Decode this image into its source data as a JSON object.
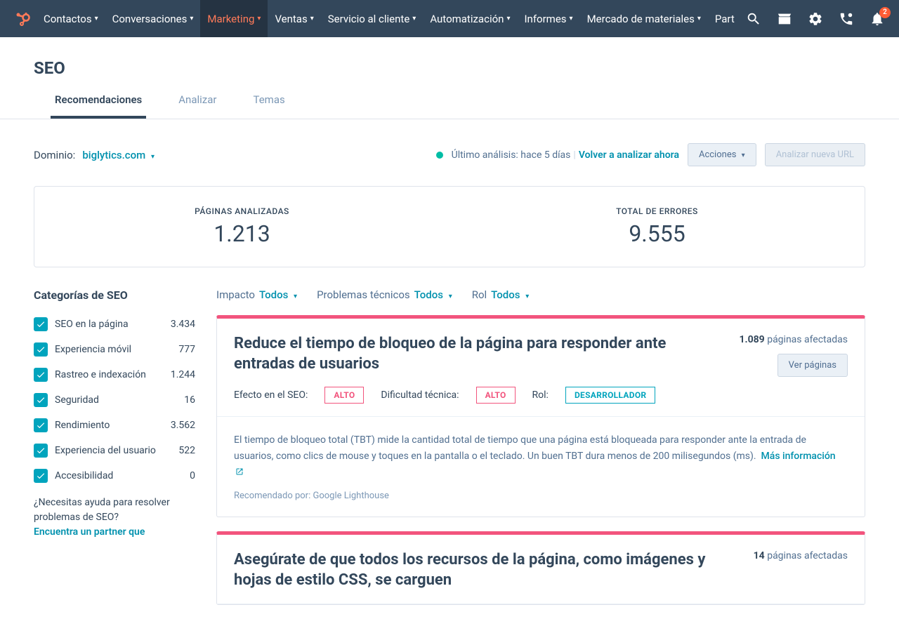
{
  "nav": {
    "items": [
      "Contactos",
      "Conversaciones",
      "Marketing",
      "Ventas",
      "Servicio al cliente",
      "Automatización",
      "Informes",
      "Mercado de materiales",
      "Part"
    ],
    "active_index": 2,
    "notification_count": "2"
  },
  "page_title": "SEO",
  "tabs": {
    "items": [
      "Recomendaciones",
      "Analizar",
      "Temas"
    ],
    "active_index": 0
  },
  "domain": {
    "label": "Dominio:",
    "value": "biglytics.com"
  },
  "status": {
    "last_scan": "Último análisis: hace 5 días",
    "reanalyze": "Volver a analizar ahora",
    "actions_btn": "Acciones",
    "new_url_btn": "Analizar nueva URL"
  },
  "stats": {
    "pages_label": "PÁGINAS ANALIZADAS",
    "pages_value": "1.213",
    "errors_label": "TOTAL DE ERRORES",
    "errors_value": "9.555"
  },
  "sidebar": {
    "title": "Categorías de SEO",
    "categories": [
      {
        "label": "SEO en la página",
        "count": "3.434"
      },
      {
        "label": "Experiencia móvil",
        "count": "777"
      },
      {
        "label": "Rastreo e indexación",
        "count": "1.244"
      },
      {
        "label": "Seguridad",
        "count": "16"
      },
      {
        "label": "Rendimiento",
        "count": "3.562"
      },
      {
        "label": "Experiencia del usuario",
        "count": "522"
      },
      {
        "label": "Accesibilidad",
        "count": "0"
      }
    ],
    "help_q": "¿Necesitas ayuda para resolver problemas de SEO?",
    "help_link": "Encuentra un partner que"
  },
  "filters": {
    "impact_label": "Impacto",
    "impact_value": "Todos",
    "tech_label": "Problemas técnicos",
    "tech_value": "Todos",
    "role_label": "Rol",
    "role_value": "Todos"
  },
  "cards": [
    {
      "title": "Reduce el tiempo de bloqueo de la página para responder ante entradas de usuarios",
      "affected_count": "1.089",
      "affected_text": "páginas afectadas",
      "view_btn": "Ver páginas",
      "effect_label": "Efecto en el SEO:",
      "effect_val": "ALTO",
      "diff_label": "Dificultad técnica:",
      "diff_val": "ALTO",
      "role_label": "Rol:",
      "role_val": "DESARROLLADOR",
      "desc": "El tiempo de bloqueo total (TBT) mide la cantidad total de tiempo que una página está bloqueada para responder ante la entrada de usuarios, como clics de mouse y toques en la pantalla o el teclado. Un buen TBT dura menos de 200 milisegundos (ms).",
      "more": "Más información",
      "recby": "Recomendado por: Google Lighthouse"
    },
    {
      "title": "Asegúrate de que todos los recursos de la página, como imágenes y hojas de estilo CSS, se carguen",
      "affected_count": "14",
      "affected_text": "páginas afectadas"
    }
  ]
}
